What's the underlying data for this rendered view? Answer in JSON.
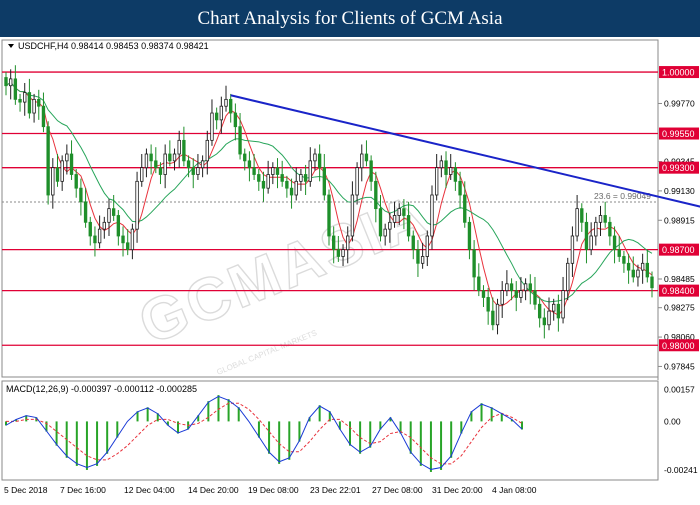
{
  "banner": {
    "title": "Chart Analysis for Clients of GCM Asia"
  },
  "colors": {
    "banner_bg": "#0d3b66",
    "support_resistance": "#e00035",
    "trendline": "#1a24c8",
    "bull_candle": "#1f1f1f",
    "bear_candle": "#1f8f2a",
    "ma_red": "#e8323c",
    "ma_green": "#27a55a",
    "macd_hist": "#28a428",
    "macd_signal": "#e8323c",
    "macd_line": "#1a3ad6"
  },
  "chart_data": [
    {
      "type": "candlestick",
      "title": "USDCHF,H4  0.98414 0.98453 0.98374 0.98421",
      "symbol": "USDCHF",
      "timeframe": "H4",
      "ohlc_last": [
        0.98414,
        0.98453,
        0.98374,
        0.98421
      ],
      "ylim": [
        0.97775,
        1.0022
      ],
      "y_ticks": [
        "0.99770",
        "0.99345",
        "0.99130",
        "0.98915",
        "0.98485",
        "0.98275",
        "0.98060",
        "0.97845"
      ],
      "x_labels": [
        "5 Dec 2018",
        "7 Dec 16:00",
        "12 Dec 04:00",
        "14 Dec 20:00",
        "19 Dec 08:00",
        "23 Dec 22:01",
        "27 Dec 08:00",
        "31 Dec 20:00",
        "4 Jan 08:00"
      ],
      "horizontal_levels": [
        {
          "label": "1.00000",
          "value": 1.0
        },
        {
          "label": "0.99550",
          "value": 0.9955
        },
        {
          "label": "0.99300",
          "value": 0.993
        },
        {
          "label": "0.98700",
          "value": 0.987
        },
        {
          "label": "0.98400",
          "value": 0.984
        },
        {
          "label": "0.98000",
          "value": 0.98
        }
      ],
      "fibonacci": {
        "label": "23.6 = 0.99049",
        "value": 0.99049
      },
      "trendline": {
        "from": {
          "bar": 48,
          "value": 0.9983
        },
        "to": {
          "bar": 160,
          "value": 0.9892
        }
      },
      "closes": [
        0.999,
        0.9995,
        0.998,
        0.9978,
        0.9985,
        0.997,
        0.998,
        0.9975,
        0.996,
        0.991,
        0.993,
        0.992,
        0.9935,
        0.994,
        0.9925,
        0.9915,
        0.9905,
        0.989,
        0.988,
        0.9875,
        0.9885,
        0.989,
        0.99,
        0.9895,
        0.988,
        0.9875,
        0.987,
        0.9885,
        0.992,
        0.993,
        0.994,
        0.9935,
        0.993,
        0.9925,
        0.994,
        0.9935,
        0.994,
        0.995,
        0.9935,
        0.993,
        0.9925,
        0.993,
        0.9935,
        0.995,
        0.997,
        0.9965,
        0.9975,
        0.998,
        0.997,
        0.996,
        0.994,
        0.9935,
        0.993,
        0.9925,
        0.992,
        0.9915,
        0.9925,
        0.993,
        0.9925,
        0.992,
        0.9915,
        0.991,
        0.992,
        0.9925,
        0.992,
        0.9935,
        0.994,
        0.993,
        0.991,
        0.988,
        0.987,
        0.9865,
        0.987,
        0.988,
        0.991,
        0.993,
        0.994,
        0.9935,
        0.992,
        0.99,
        0.988,
        0.9885,
        0.989,
        0.9895,
        0.99,
        0.9895,
        0.988,
        0.987,
        0.986,
        0.9865,
        0.988,
        0.991,
        0.993,
        0.9935,
        0.9925,
        0.993,
        0.992,
        0.991,
        0.989,
        0.987,
        0.985,
        0.984,
        0.9835,
        0.9825,
        0.9815,
        0.983,
        0.984,
        0.9845,
        0.984,
        0.9835,
        0.984,
        0.9845,
        0.984,
        0.983,
        0.982,
        0.9815,
        0.9825,
        0.983,
        0.982,
        0.984,
        0.986,
        0.988,
        0.99,
        0.989,
        0.987,
        0.988,
        0.989,
        0.9895,
        0.989,
        0.988,
        0.987,
        0.9865,
        0.986,
        0.9855,
        0.985,
        0.9855,
        0.986,
        0.985,
        0.98421
      ]
    },
    {
      "type": "line",
      "title": "MACD(12,26,9)  -0.000397  -0.000112  -0.000285",
      "ylim": [
        -0.0027,
        0.00185
      ],
      "y_ticks": [
        "0.00157",
        "0.00",
        "-0.00241"
      ],
      "series": [
        {
          "values": [
            -0.0002,
            0.0001,
            0.0003,
            0.0002,
            -0.0005,
            -0.0012,
            -0.0018,
            -0.0022,
            -0.0024,
            -0.0022,
            -0.0016,
            -0.0008,
            0.0,
            0.0005,
            0.0007,
            0.0004,
            -0.0002,
            -0.0006,
            -0.0004,
            0.0003,
            0.001,
            0.0013,
            0.0011,
            0.0007,
            0.0,
            -0.0008,
            -0.0016,
            -0.0021,
            -0.0019,
            -0.001,
            0.0002,
            0.0008,
            0.0005,
            -0.0004,
            -0.0012,
            -0.0016,
            -0.0013,
            -0.0004,
            0.0002,
            -0.0006,
            -0.0016,
            -0.0022,
            -0.0025,
            -0.0024,
            -0.0018,
            -0.0006,
            0.0005,
            0.0009,
            0.0007,
            0.0004,
            0.0001,
            -0.0004
          ]
        },
        {
          "values": [
            0.0,
            0.0,
            0.0001,
            0.0001,
            -0.0001,
            -0.0005,
            -0.0009,
            -0.0013,
            -0.0017,
            -0.0019,
            -0.0019,
            -0.0016,
            -0.0012,
            -0.0007,
            -0.0002,
            0.0001,
            0.0001,
            -0.0001,
            -0.0002,
            -0.0001,
            0.0002,
            0.0006,
            0.0009,
            0.0009,
            0.0006,
            0.0001,
            -0.0005,
            -0.0011,
            -0.0015,
            -0.0015,
            -0.001,
            -0.0004,
            0.0001,
            0.0001,
            -0.0003,
            -0.0008,
            -0.0011,
            -0.001,
            -0.0006,
            -0.0005,
            -0.0008,
            -0.0013,
            -0.0018,
            -0.0021,
            -0.0021,
            -0.0017,
            -0.001,
            -0.0003,
            0.0002,
            0.0004,
            0.0002,
            -0.0001
          ]
        }
      ]
    }
  ],
  "watermark": {
    "text": "GCMASIA",
    "subtext": "GLOBAL CAPITAL MARKETS"
  }
}
